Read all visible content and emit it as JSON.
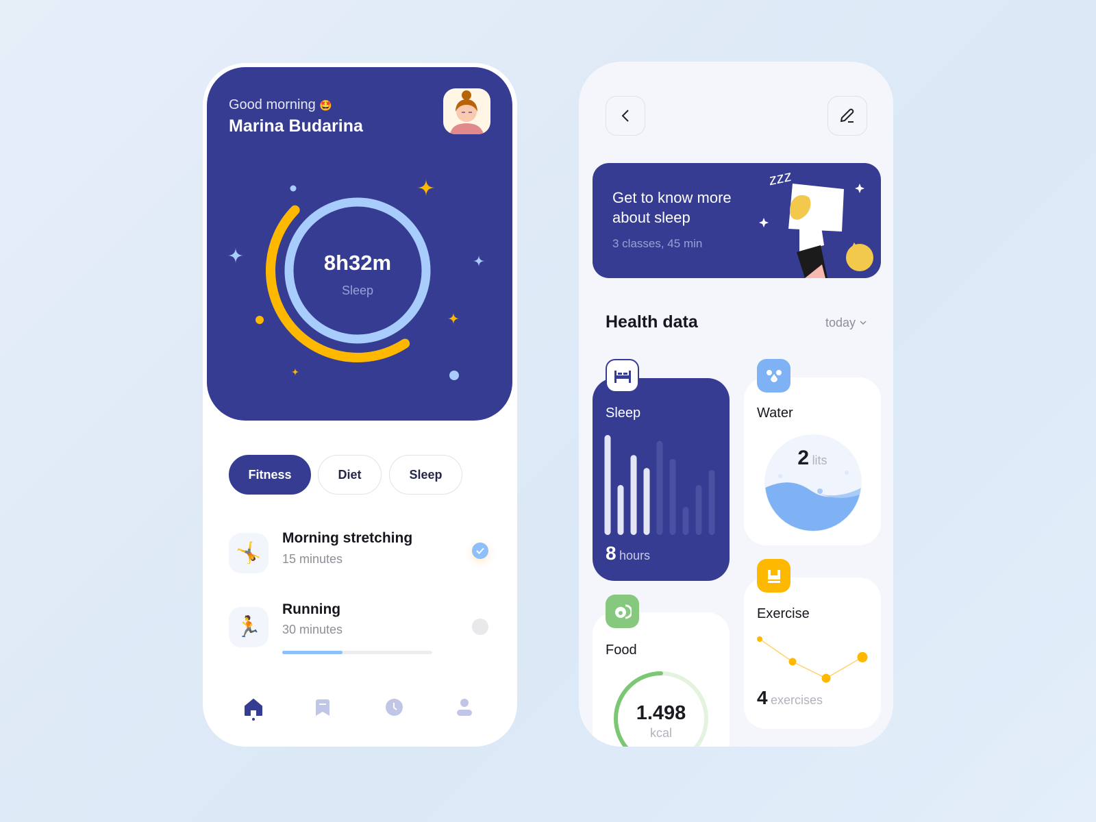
{
  "home": {
    "greeting": "Good morning",
    "greeting_emoji": "🤩",
    "user_name": "Marina Budarina",
    "sleep_total": "8h32m",
    "sleep_label": "Sleep",
    "colors": {
      "primary": "#353c92",
      "ring_blue": "#a8cdfc",
      "ring_yellow": "#ffb800"
    },
    "tabs": [
      {
        "label": "Fitness",
        "active": true
      },
      {
        "label": "Diet",
        "active": false
      },
      {
        "label": "Sleep",
        "active": false
      }
    ],
    "activities": [
      {
        "title": "Morning stretching",
        "duration": "15 minutes",
        "icon": "cartwheel-person-icon",
        "completed": true
      },
      {
        "title": "Running",
        "duration": "30 minutes",
        "icon": "running-person-icon",
        "completed": false,
        "progress": 0.4
      }
    ],
    "nav": [
      "home-icon",
      "bookmark-icon",
      "clock-icon",
      "profile-icon"
    ]
  },
  "detail": {
    "banner": {
      "title_line1": "Get to know more",
      "title_line2": "about sleep",
      "subtitle": "3 classes, 45 min"
    },
    "section_title": "Health data",
    "period": "today",
    "sleep": {
      "label": "Sleep",
      "value": "8",
      "unit": "hours",
      "bars": [
        10,
        5,
        8,
        6.7,
        9.4,
        7.6,
        2.8,
        5,
        6.5
      ],
      "highlighted_bars": 4
    },
    "water": {
      "label": "Water",
      "value": "2",
      "unit": "lits"
    },
    "exercise": {
      "label": "Exercise",
      "value": "4",
      "unit": "exercises",
      "points": [
        4,
        2.5,
        1.4,
        2.8
      ]
    },
    "food": {
      "label": "Food",
      "value": "1.498",
      "unit": "kcal",
      "progress": 0.6
    }
  }
}
